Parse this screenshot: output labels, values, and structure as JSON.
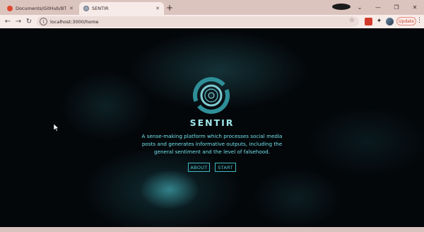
{
  "browser": {
    "tabs": [
      {
        "title": "Documents/GitHub/BT4222-Ho",
        "active": false
      },
      {
        "title": "SENTIR",
        "active": true
      }
    ],
    "url": "localhost:3000/home",
    "update_label": "Update"
  },
  "page": {
    "brand": "SENTIR",
    "tagline": "A sense-making platform which processes social media posts and generates informative outputs, including the general sentiment and the level of falsehood.",
    "buttons": {
      "about": "ABOUT",
      "start": "START"
    }
  },
  "colors": {
    "accent": "#3fb8c2",
    "brand_text": "#9fe7ea",
    "background": "#04070a",
    "browser_chrome": "#dcc4be",
    "update_button": "#c4452f"
  },
  "icons": {
    "logo": "concentric-ring-logo",
    "reload": "reload-icon",
    "back": "back-arrow-icon",
    "forward": "forward-arrow-icon",
    "star": "star-icon",
    "extensions": "puzzle-icon"
  }
}
